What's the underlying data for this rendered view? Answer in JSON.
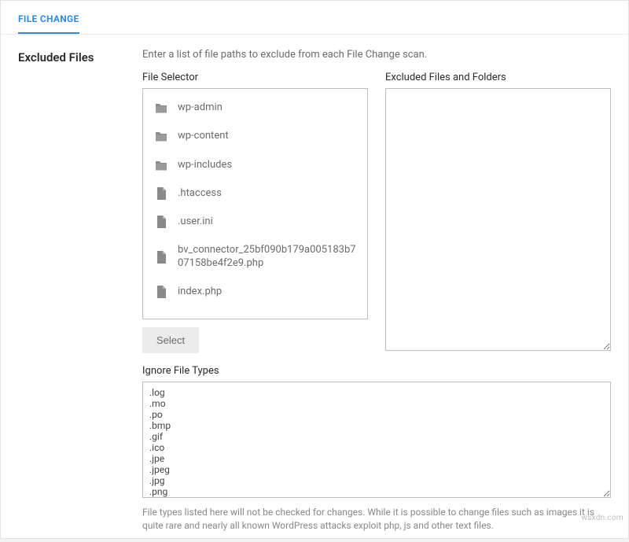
{
  "tab_label": "FILE CHANGE",
  "section_title": "Excluded Files",
  "description": "Enter a list of file paths to exclude from each File Change scan.",
  "file_selector": {
    "label": "File Selector",
    "items": [
      {
        "name": "wp-admin",
        "type": "folder"
      },
      {
        "name": "wp-content",
        "type": "folder"
      },
      {
        "name": "wp-includes",
        "type": "folder"
      },
      {
        "name": ".htaccess",
        "type": "file"
      },
      {
        "name": ".user.ini",
        "type": "file"
      },
      {
        "name": "bv_connector_25bf090b179a005183b707158be4f2e9.php",
        "type": "file"
      },
      {
        "name": "index.php",
        "type": "file"
      }
    ],
    "select_button": "Select"
  },
  "excluded": {
    "label": "Excluded Files and Folders",
    "value": ""
  },
  "ignore_types": {
    "label": "Ignore File Types",
    "value": ".log\n.mo\n.po\n.bmp\n.gif\n.ico\n.jpe\n.jpeg\n.jpg\n.png",
    "help": "File types listed here will not be checked for changes. While it is possible to change files such as images it is quite rare and nearly all known WordPress attacks exploit php, js and other text files."
  },
  "watermark": "wsxdn.com"
}
